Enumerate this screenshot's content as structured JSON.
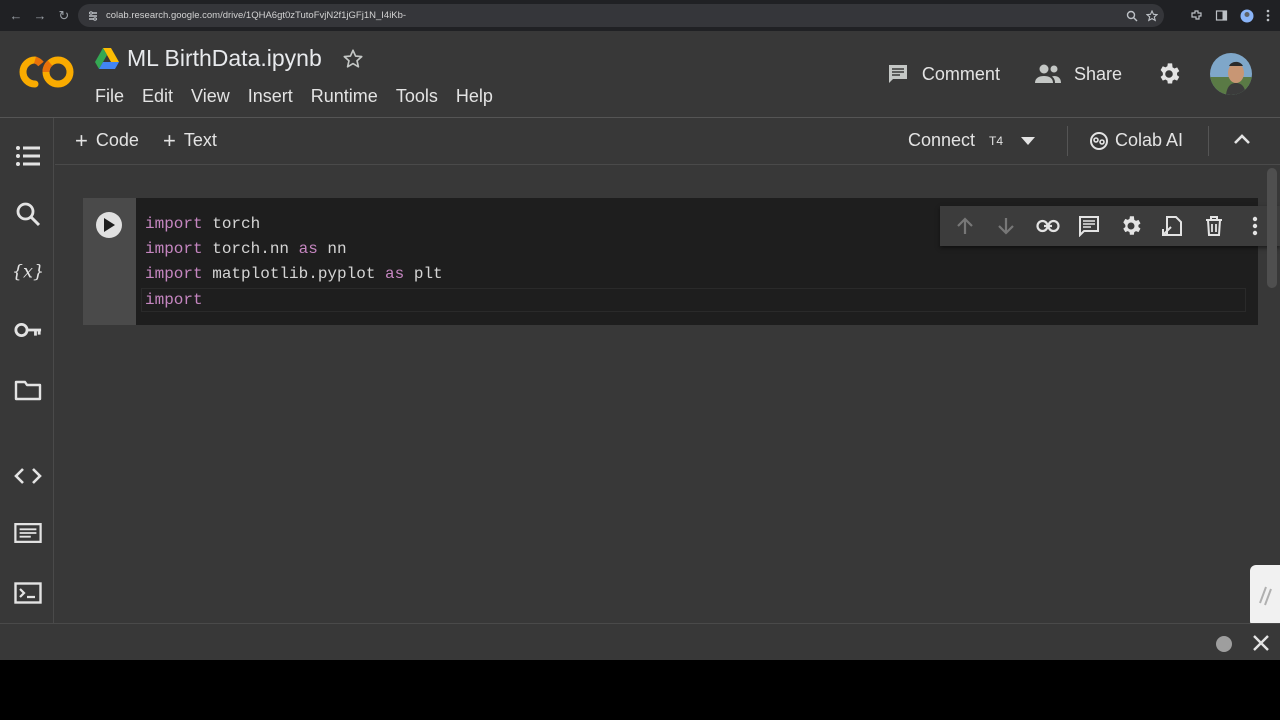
{
  "browser": {
    "url": "colab.research.google.com/drive/1QHA6gt0zTutoFvjN2f1jGFj1N_I4iKb-"
  },
  "header": {
    "logo_text": "CO",
    "doc_title": "ML BirthData.ipynb",
    "menu": [
      "File",
      "Edit",
      "View",
      "Insert",
      "Runtime",
      "Tools",
      "Help"
    ],
    "comment_label": "Comment",
    "share_label": "Share"
  },
  "toolbar": {
    "add_code_label": "Code",
    "add_text_label": "Text",
    "connect_label": "Connect",
    "runtime_type": "T4",
    "colab_ai_label": "Colab AI"
  },
  "cell": {
    "lines": [
      {
        "kw1": "import",
        "rest1": " torch",
        "kw2": "",
        "rest2": ""
      },
      {
        "kw1": "import",
        "rest1": " torch.nn ",
        "kw2": "as",
        "rest2": " nn"
      },
      {
        "kw1": "import",
        "rest1": " matplotlib.pyplot ",
        "kw2": "as",
        "rest2": " plt"
      },
      {
        "kw1": "import",
        "rest1": "",
        "kw2": "",
        "rest2": ""
      }
    ]
  },
  "sidebar": {
    "items": [
      "toc-icon",
      "search-icon",
      "variables-icon",
      "secrets-icon",
      "files-icon",
      "code-snippets-icon",
      "command-palette-icon",
      "terminal-icon"
    ]
  },
  "colors": {
    "background": "#383838",
    "keyword": "#c586c0",
    "logo_orange": "#f9ab00"
  }
}
